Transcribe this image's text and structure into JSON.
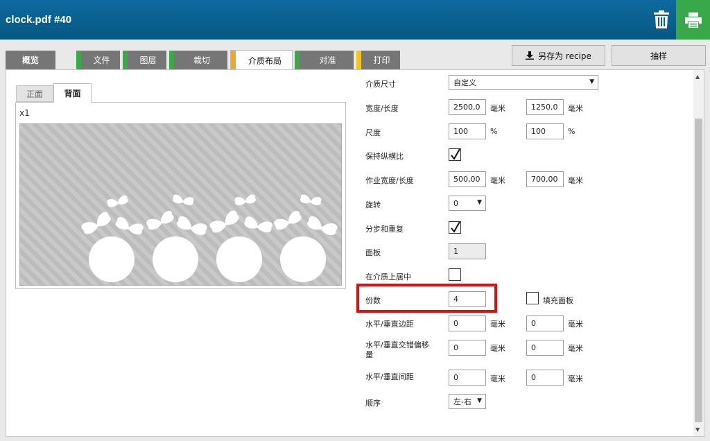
{
  "window": {
    "title": "clock.pdf #40"
  },
  "toolbar": {
    "delete_icon": "trash-icon",
    "print_icon": "printer-icon"
  },
  "tabs": [
    {
      "label": "概览",
      "stripe": ""
    },
    {
      "label": "文件",
      "stripe": "#3aaa47"
    },
    {
      "label": "图层",
      "stripe": "#3aaa47"
    },
    {
      "label": "裁切",
      "stripe": "#3aaa47"
    },
    {
      "label": "介质布局",
      "stripe": "#f5a623"
    },
    {
      "label": "对准",
      "stripe": "#3aaa47"
    },
    {
      "label": "打印",
      "stripe": "#f5c518"
    }
  ],
  "actions": {
    "save_recipe": "另存为 recipe",
    "sample": "抽样"
  },
  "preview": {
    "tabs": [
      "正面",
      "背面"
    ],
    "copies_label": "x1"
  },
  "form": {
    "media_size": {
      "label": "介质尺寸",
      "value": "自定义"
    },
    "width_length": {
      "label": "宽度/长度",
      "width": "2500,0",
      "length": "1250,0",
      "unit": "毫米"
    },
    "scale": {
      "label": "尺度",
      "x": "100",
      "y": "100",
      "unit": "%"
    },
    "keep_ratio": {
      "label": "保持纵横比",
      "checked": true
    },
    "job_size": {
      "label": "作业宽度/长度",
      "width": "500,00",
      "length": "700,00",
      "unit": "毫米"
    },
    "rotate": {
      "label": "旋转",
      "value": "0"
    },
    "step_repeat": {
      "label": "分步和重复",
      "checked": true
    },
    "panels": {
      "label": "面板",
      "value": "1"
    },
    "center_on_media": {
      "label": "在介质上居中",
      "checked": false
    },
    "copies": {
      "label": "份数",
      "value": "4"
    },
    "fill_panel": {
      "label": "填充面板",
      "checked": false
    },
    "margins": {
      "label": "水平/垂直边距",
      "h": "0",
      "v": "0",
      "unit": "毫米"
    },
    "stagger_offset": {
      "label_line1": "水平/垂直交错偏移",
      "label_line2": "量",
      "h": "0",
      "v": "0",
      "unit": "毫米"
    },
    "spacing": {
      "label": "水平/垂直间距",
      "h": "0",
      "v": "0",
      "unit": "毫米"
    },
    "order": {
      "label": "顺序",
      "value": "左-右"
    }
  },
  "colors": {
    "header": "#0b6496",
    "print_button": "#39a84a",
    "highlight": "#e01010"
  }
}
